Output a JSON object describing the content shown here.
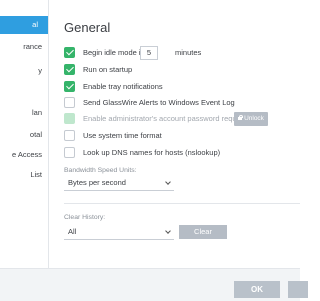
{
  "sidebar": {
    "items": [
      {
        "label": "al",
        "active": true
      },
      {
        "label": "rance",
        "active": false
      },
      {
        "label": "y",
        "active": false
      },
      {
        "label": "lan",
        "active": false
      },
      {
        "label": "otal",
        "active": false
      },
      {
        "label": "e Access",
        "active": false
      },
      {
        "label": "List",
        "active": false
      }
    ]
  },
  "main": {
    "title": "General",
    "idle": {
      "label": "Begin idle mode in",
      "value": "5",
      "unit": "minutes",
      "checked": true
    },
    "options": [
      {
        "label": "Run on startup",
        "checked": true,
        "disabled": false
      },
      {
        "label": "Enable tray notifications",
        "checked": true,
        "disabled": false
      },
      {
        "label": "Send GlassWire Alerts to Windows Event Log",
        "checked": false,
        "disabled": false
      },
      {
        "label": "Enable administrator's account password request",
        "checked": true,
        "disabled": true
      },
      {
        "label": "Use system time format",
        "checked": false,
        "disabled": false
      },
      {
        "label": "Look up DNS names for hosts (nslookup)",
        "checked": false,
        "disabled": false
      }
    ],
    "unlock_label": "Unlock",
    "bandwidth": {
      "label": "Bandwidth Speed Units:",
      "selected": "Bytes per second"
    },
    "clear_history": {
      "label": "Clear History:",
      "selected": "All",
      "button_label": "Clear"
    }
  },
  "footer": {
    "ok_label": "OK"
  }
}
